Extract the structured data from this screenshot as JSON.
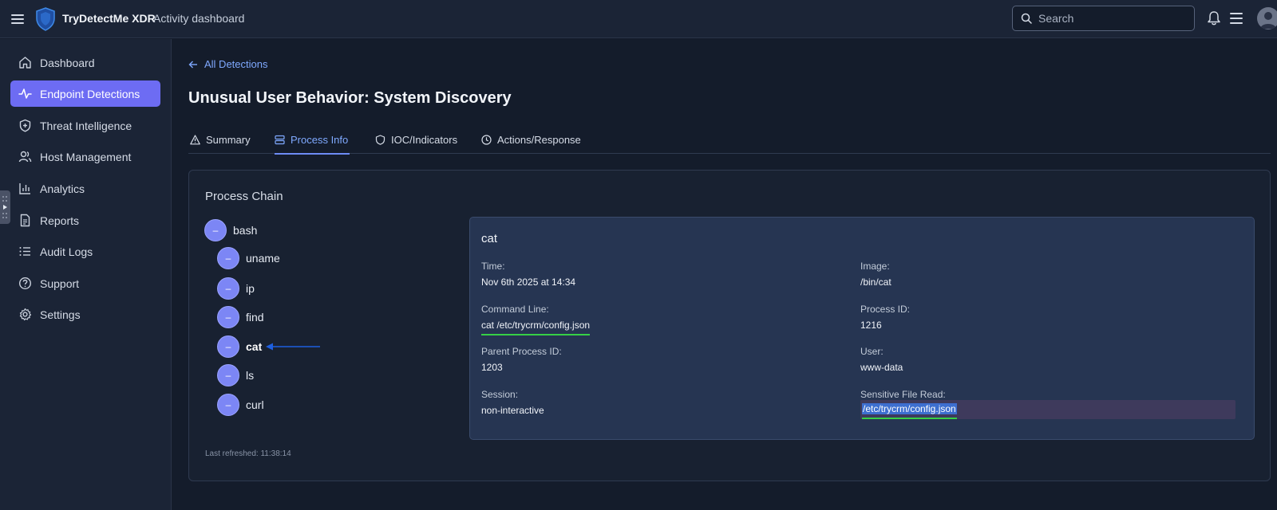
{
  "header": {
    "brand": "TryDetectMe XDR",
    "subtitle": "Activity dashboard",
    "search_placeholder": "Search"
  },
  "sidebar": {
    "items": [
      {
        "label": "Dashboard",
        "icon": "home-icon"
      },
      {
        "label": "Endpoint Detections",
        "icon": "activity-icon",
        "active": true
      },
      {
        "label": "Threat Intelligence",
        "icon": "shield-plus-icon"
      },
      {
        "label": "Host Management",
        "icon": "users-icon"
      },
      {
        "label": "Analytics",
        "icon": "bar-chart-icon"
      },
      {
        "label": "Reports",
        "icon": "file-text-icon"
      },
      {
        "label": "Audit Logs",
        "icon": "list-icon"
      },
      {
        "label": "Support",
        "icon": "help-circle-icon"
      },
      {
        "label": "Settings",
        "icon": "gear-icon"
      }
    ]
  },
  "main": {
    "back_link": "All Detections",
    "title": "Unusual User Behavior: System Discovery",
    "tabs": [
      {
        "label": "Summary",
        "icon": "alert-triangle-icon"
      },
      {
        "label": "Process Info",
        "icon": "server-icon",
        "active": true
      },
      {
        "label": "IOC/Indicators",
        "icon": "shield-icon"
      },
      {
        "label": "Actions/Response",
        "icon": "clock-icon"
      }
    ]
  },
  "process_chain": {
    "title": "Process Chain",
    "root": "bash",
    "children": [
      "uname",
      "ip",
      "find",
      "cat",
      "ls",
      "curl"
    ],
    "selected": "cat",
    "node_symbol": "–",
    "last_refreshed": "Last refreshed: 11:38:14"
  },
  "detail": {
    "title": "cat",
    "time_label": "Time:",
    "time_value": "Nov 6th 2025 at 14:34",
    "image_label": "Image:",
    "image_value": "/bin/cat",
    "cmdline_label": "Command Line:",
    "cmdline_value": "cat /etc/trycrm/config.json",
    "pid_label": "Process ID:",
    "pid_value": "1216",
    "ppid_label": "Parent Process ID:",
    "ppid_value": "1203",
    "user_label": "User:",
    "user_value": "www-data",
    "session_label": "Session:",
    "session_value": "non-interactive",
    "sensitive_label": "Sensitive File Read:",
    "sensitive_value": "/etc/trycrm/config.json"
  },
  "colors": {
    "accent": "#6d6cf3",
    "link": "#7fa9ff",
    "highlight_underline": "#36d146"
  }
}
